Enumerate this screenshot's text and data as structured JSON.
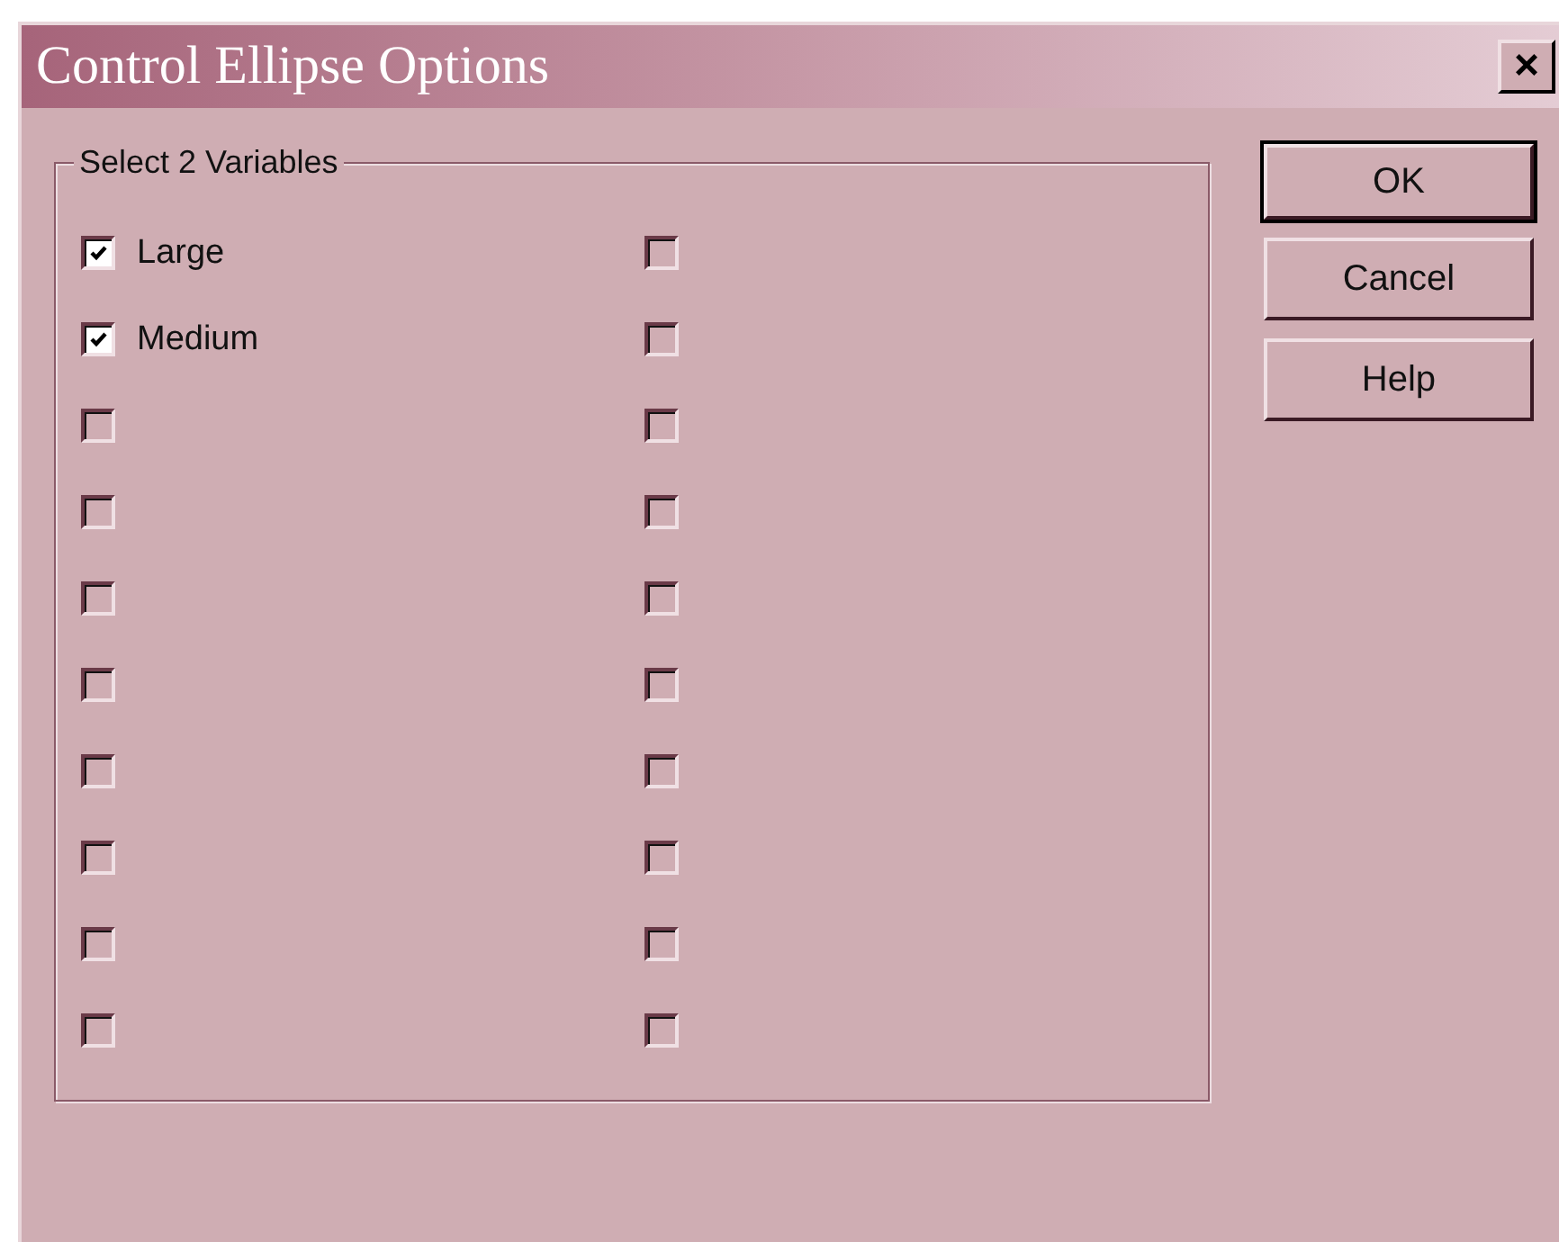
{
  "window": {
    "title": "Control Ellipse Options",
    "close": "×"
  },
  "group": {
    "title": "Select 2 Variables",
    "columns": [
      [
        {
          "label": "Large",
          "checked": true
        },
        {
          "label": "Medium",
          "checked": true
        },
        {
          "checked": false
        },
        {
          "checked": false
        },
        {
          "checked": false
        },
        {
          "checked": false
        },
        {
          "checked": false
        },
        {
          "checked": false
        },
        {
          "checked": false
        },
        {
          "checked": false
        }
      ],
      [
        {
          "checked": false
        },
        {
          "checked": false
        },
        {
          "checked": false
        },
        {
          "checked": false
        },
        {
          "checked": false
        },
        {
          "checked": false
        },
        {
          "checked": false
        },
        {
          "checked": false
        },
        {
          "checked": false
        },
        {
          "checked": false
        }
      ]
    ]
  },
  "buttons": [
    {
      "label": "OK",
      "default": true
    },
    {
      "label": "Cancel",
      "default": false
    },
    {
      "label": "Help",
      "default": false
    }
  ]
}
